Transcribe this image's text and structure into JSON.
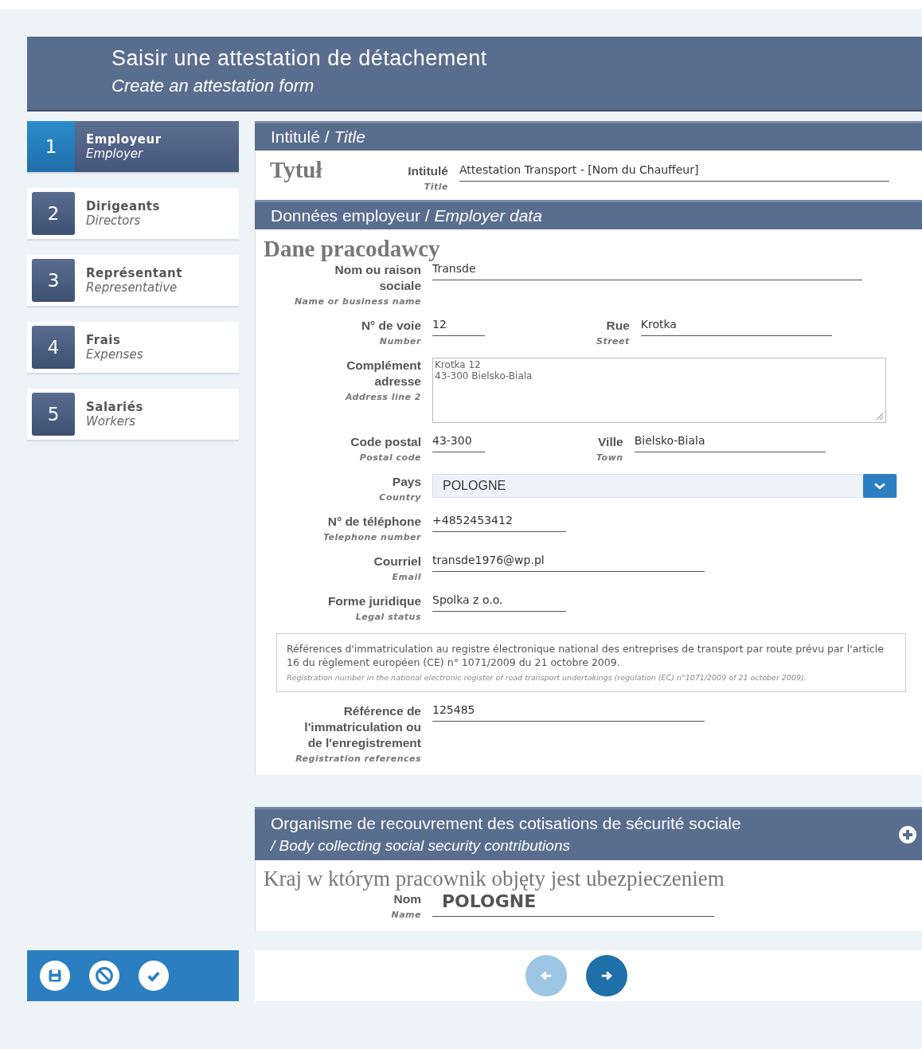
{
  "header": {
    "title": "Saisir une attestation de détachement",
    "subtitle": "Create an attestation form"
  },
  "steps": [
    {
      "number": "1",
      "label": "Employeur",
      "sublabel": "Employer",
      "selected": true
    },
    {
      "number": "2",
      "label": "Dirigeants",
      "sublabel": "Directors",
      "selected": false
    },
    {
      "number": "3",
      "label": "Représentant",
      "sublabel": "Representative",
      "selected": false
    },
    {
      "number": "4",
      "label": "Frais",
      "sublabel": "Expenses",
      "selected": false
    },
    {
      "number": "5",
      "label": "Salariés",
      "sublabel": "Workers",
      "selected": false
    }
  ],
  "sections": [
    {
      "title": "Intitulé /",
      "title_en": "Title",
      "heading": "Tytuł",
      "kind": "inline",
      "rows": [
        {
          "kind": "fields",
          "fields": [
            {
              "label": "Intitulé",
              "label_en": "Title",
              "value": "Attestation Transport - [Nom du Chauffeur]",
              "kind": "long"
            }
          ]
        }
      ]
    },
    {
      "title": "Données employeur /",
      "title_en": "Employer data",
      "heading": "Dane pracodawcy",
      "kind": "block",
      "rows": [
        {
          "kind": "fields",
          "fields": [
            {
              "label": "Nom ou raison sociale",
              "label_en": "Name or business name",
              "value": "Transde",
              "kind": "long"
            }
          ]
        },
        {
          "kind": "fields",
          "fields": [
            {
              "label": "N° de voie",
              "label_en": "Number",
              "value": "12",
              "kind": "tiny"
            },
            {
              "label": "Rue",
              "label_en": "Street",
              "value": "Krotka",
              "kind": "medium"
            }
          ]
        },
        {
          "kind": "fields",
          "fields": [
            {
              "label": "Complément adresse",
              "label_en": "Address line 2",
              "value": "Krotka 12\n43-300 Bielsko-Biala",
              "kind": "textarea"
            }
          ]
        },
        {
          "kind": "fields",
          "fields": [
            {
              "label": "Code postal",
              "label_en": "Postal code",
              "value": "43-300",
              "kind": "tiny"
            },
            {
              "label": "Ville",
              "label_en": "Town",
              "value": "Bielsko-Biala",
              "kind": "medium"
            }
          ]
        },
        {
          "kind": "fields",
          "fields": [
            {
              "label": "Pays",
              "label_en": "Country",
              "value": "POLOGNE",
              "kind": "select"
            }
          ]
        },
        {
          "kind": "fields",
          "fields": [
            {
              "label": "N° de téléphone",
              "label_en": "Telephone number",
              "value": "+4852453412",
              "kind": "small"
            }
          ]
        },
        {
          "kind": "fields",
          "fields": [
            {
              "label": "Courriel",
              "label_en": "Email",
              "value": "transde1976@wp.pl",
              "kind": "half"
            }
          ]
        },
        {
          "kind": "fields",
          "fields": [
            {
              "label": "Forme juridique",
              "label_en": "Legal status",
              "value": "Spolka z o.o.",
              "kind": "small"
            }
          ]
        },
        {
          "kind": "note",
          "text": "Références d'immatriculation au registre électronique national des entreprises de transport par route prévu par l'article 16 du règlement européen (CE) n° 1071/2009 du 21 octobre 2009.",
          "text_en": "Registration number in the national electronic register of road transport undertakings (regulation (EC) n°1071/2009 of 21 october 2009)."
        },
        {
          "kind": "fields",
          "fields": [
            {
              "label": "Référence de l'immatriculation ou de l'enregistrement",
              "label_en": "Registration references",
              "value": "125485",
              "kind": "half"
            }
          ]
        }
      ]
    },
    {
      "title": "Organisme de recouvrement des cotisations de sécurité sociale",
      "title_en": "/ Body collecting social security contributions",
      "heading": "Kraj w którym pracownik objęty jest ubezpieczeniem",
      "kind": "block",
      "addable": true,
      "rows": [
        {
          "kind": "fields",
          "fields": [
            {
              "label": "Nom",
              "label_en": "Name",
              "value": "POLOGNE",
              "kind": "strong"
            }
          ]
        }
      ]
    }
  ],
  "actions": [
    {
      "kind": "save"
    },
    {
      "kind": "cancel"
    },
    {
      "kind": "validate"
    }
  ],
  "pager": [
    {
      "kind": "prev",
      "disabled": true
    },
    {
      "kind": "next",
      "disabled": false
    }
  ]
}
